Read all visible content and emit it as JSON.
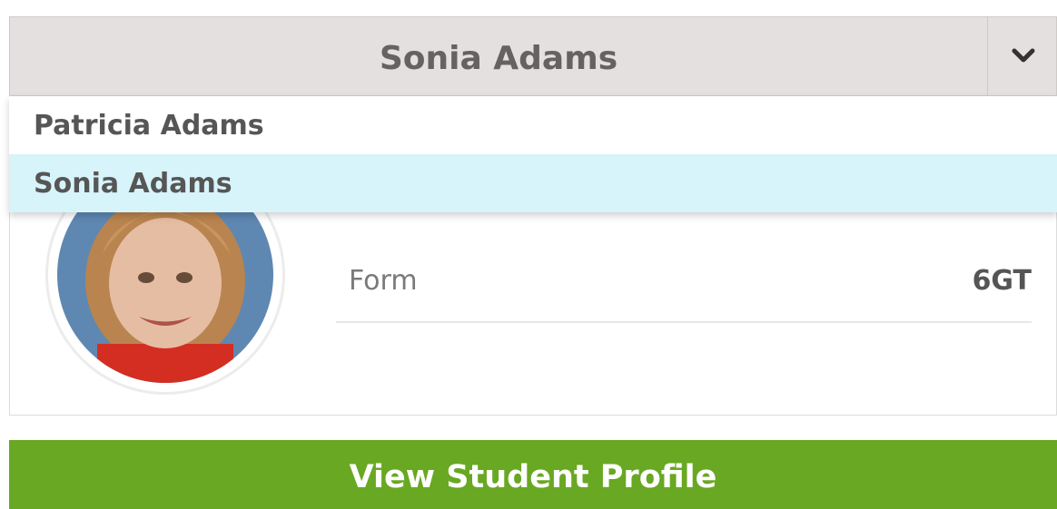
{
  "student_selector": {
    "selected": "Sonia Adams",
    "options": [
      "Patricia Adams",
      "Sonia Adams"
    ]
  },
  "profile": {
    "form_label": "Form",
    "form_value": "6GT"
  },
  "actions": {
    "view_profile_label": "View Student Profile"
  },
  "colors": {
    "primary_action": "#69a822",
    "selected_option": "#d8f4fb",
    "selector_bg": "#e3e0df"
  }
}
